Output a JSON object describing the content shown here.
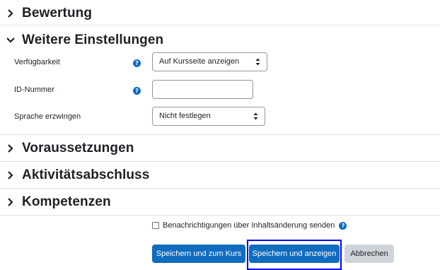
{
  "sections": {
    "bewertung": "Bewertung",
    "weitere": "Weitere Einstellungen",
    "voraussetzungen": "Voraussetzungen",
    "aktivitaet": "Aktivitätsabschluss",
    "kompetenzen": "Kompetenzen"
  },
  "fields": {
    "verfuegbarkeit": {
      "label": "Verfügbarkeit",
      "value": "Auf Kursseite anzeigen"
    },
    "id_nummer": {
      "label": "ID-Nummer",
      "value": ""
    },
    "sprache": {
      "label": "Sprache erzwingen",
      "value": "Nicht festlegen"
    }
  },
  "notify": {
    "label": "Benachrichtigungen über Inhaltsänderung senden",
    "checked": false
  },
  "buttons": {
    "save_course": "Speichern und zum Kurs",
    "save_show": "Speichern und anzeigen",
    "cancel": "Abbrechen"
  },
  "colors": {
    "primary": "#0f6cbf",
    "secondary": "#ced4da",
    "focus": "#0000ff"
  },
  "icons": {
    "collapsed": "chevron-right-icon",
    "expanded": "chevron-down-icon",
    "help": "help-icon"
  }
}
